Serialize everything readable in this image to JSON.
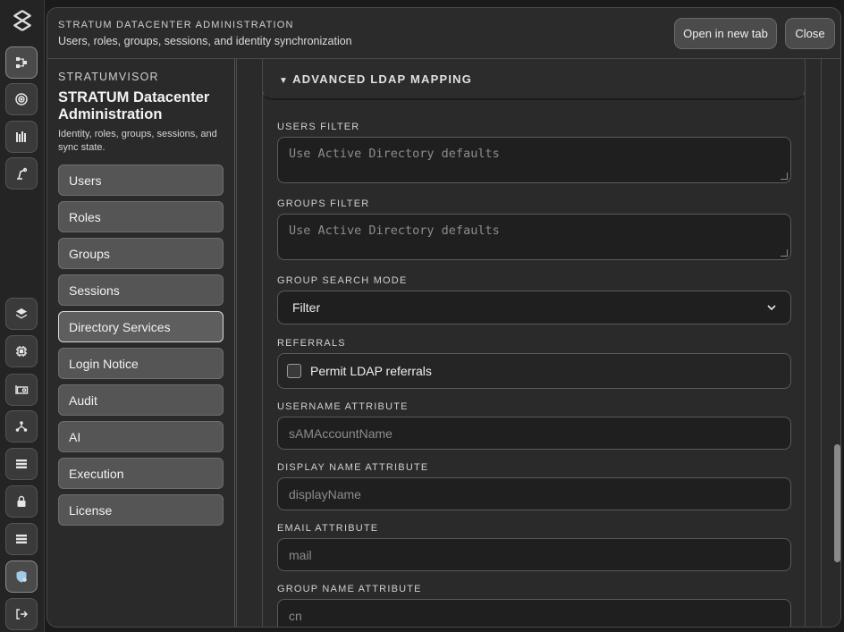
{
  "header": {
    "kicker": "STRATUM DATACENTER ADMINISTRATION",
    "subtitle": "Users, roles, groups, sessions, and identity synchronization",
    "open_new_tab_label": "Open in new tab",
    "close_label": "Close"
  },
  "sidebar": {
    "kicker": "STRATUMVISOR",
    "title": "STRATUM Datacenter Administration",
    "description": "Identity, roles, groups, sessions, and sync state.",
    "items": [
      {
        "label": "Users"
      },
      {
        "label": "Roles"
      },
      {
        "label": "Groups"
      },
      {
        "label": "Sessions"
      },
      {
        "label": "Directory Services",
        "active": true
      },
      {
        "label": "Login Notice"
      },
      {
        "label": "Audit"
      },
      {
        "label": "AI"
      },
      {
        "label": "Execution"
      },
      {
        "label": "License"
      }
    ]
  },
  "section": {
    "title": "ADVANCED LDAP MAPPING",
    "users_filter": {
      "label": "USERS FILTER",
      "placeholder": "Use Active Directory defaults"
    },
    "groups_filter": {
      "label": "GROUPS FILTER",
      "placeholder": "Use Active Directory defaults"
    },
    "group_search_mode": {
      "label": "GROUP SEARCH MODE",
      "value": "Filter"
    },
    "referrals": {
      "label": "REFERRALS",
      "checkbox_label": "Permit LDAP referrals",
      "checked": false
    },
    "username_attribute": {
      "label": "USERNAME ATTRIBUTE",
      "placeholder": "sAMAccountName"
    },
    "display_name_attribute": {
      "label": "DISPLAY NAME ATTRIBUTE",
      "placeholder": "displayName"
    },
    "email_attribute": {
      "label": "EMAIL ATTRIBUTE",
      "placeholder": "mail"
    },
    "group_name_attribute": {
      "label": "GROUP NAME ATTRIBUTE",
      "placeholder": "cn"
    }
  },
  "rail": {
    "icons": [
      "stratum-logo-icon",
      "topology-icon",
      "target-icon",
      "datacenter-icon",
      "robot-arm-icon",
      "layers-icon",
      "cpu-icon",
      "gpu-card-icon",
      "network-icon",
      "storage-icon",
      "lock-icon",
      "server-list-icon",
      "admin-shield-icon",
      "logout-icon"
    ]
  },
  "colors": {
    "background": "#1b1b1b",
    "panel": "#2a2a2a",
    "nav_item": "#555555",
    "field": "#1f1f1f",
    "accent_border": "#d8d8d8"
  }
}
